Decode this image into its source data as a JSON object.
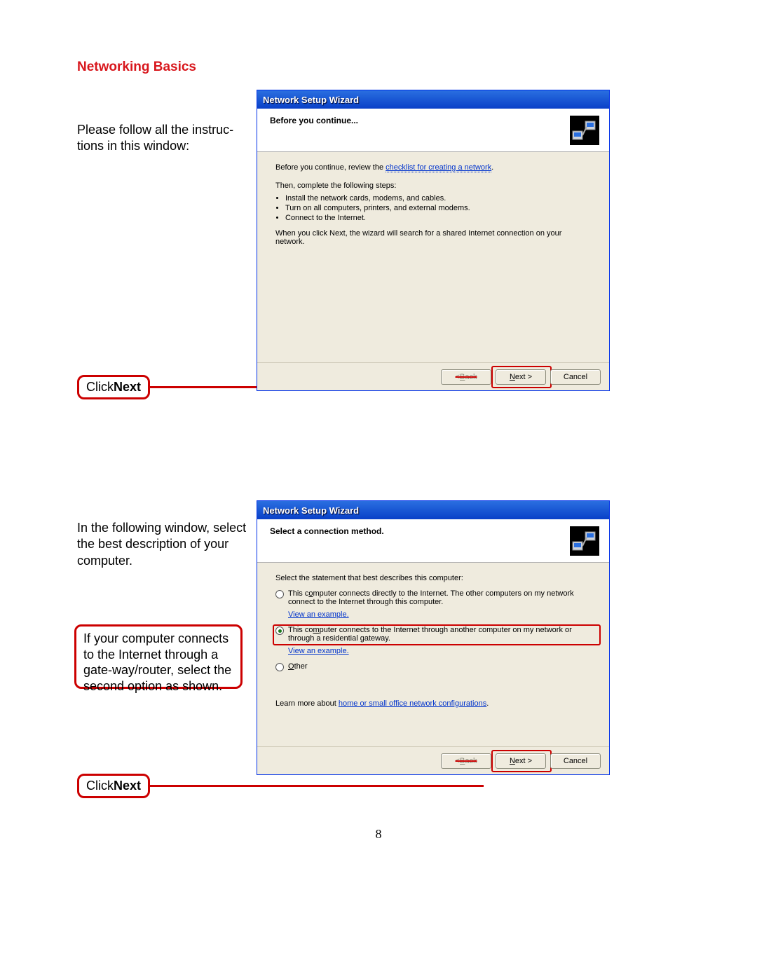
{
  "page": {
    "heading": "Networking Basics",
    "number": "8"
  },
  "left": {
    "instr1": "Please follow all the instruc-\ntions in this window:",
    "callout_click": "Click ",
    "callout_next": "Next",
    "instr2": "In the following window, select the best description of your computer.",
    "instr3": "If your computer connects to the Internet through a gate-way/router, select the second option as shown."
  },
  "wizard1": {
    "title": "Network Setup Wizard",
    "header": "Before you continue...",
    "body": {
      "line1_a": "Before you continue, review the ",
      "line1_link": "checklist for creating a network",
      "line1_b": ".",
      "line2": "Then, complete the following steps:",
      "bullet1": "Install the network cards, modems, and cables.",
      "bullet2": "Turn on all computers, printers, and external modems.",
      "bullet3": "Connect to the Internet.",
      "line3": "When you click Next, the wizard will search for a shared Internet connection on your network."
    },
    "buttons": {
      "back": "< Back",
      "next": "Next >",
      "cancel": "Cancel"
    }
  },
  "wizard2": {
    "title": "Network Setup Wizard",
    "header": "Select a connection method.",
    "body": {
      "prompt": "Select the statement that best describes this computer:",
      "opt1": "This computer connects directly to the Internet. The other computers on my network connect to the Internet through this computer.",
      "opt2": "This computer connects to the Internet through another computer on my network or through a residential gateway.",
      "opt3": "Other",
      "view": "View an example.",
      "learn_a": "Learn more about ",
      "learn_link": "home or small office network configurations",
      "learn_b": "."
    },
    "buttons": {
      "back": "< Back",
      "next": "Next >",
      "cancel": "Cancel"
    }
  }
}
